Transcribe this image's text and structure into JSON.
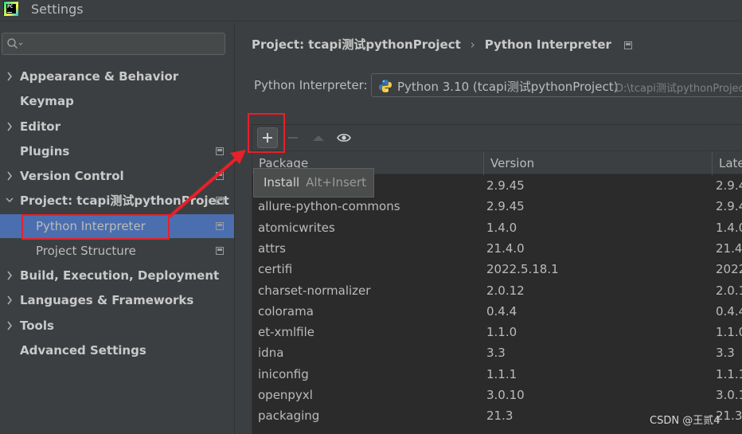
{
  "window": {
    "title": "Settings"
  },
  "sidebar": {
    "search_placeholder": "",
    "items": [
      {
        "label": "Appearance & Behavior",
        "expandable": true,
        "expanded": false
      },
      {
        "label": "Keymap",
        "expandable": false
      },
      {
        "label": "Editor",
        "expandable": true,
        "expanded": false
      },
      {
        "label": "Plugins",
        "expandable": false
      },
      {
        "label": "Version Control",
        "expandable": true,
        "expanded": false
      },
      {
        "label": "Project: tcapi测试pythonProject",
        "expandable": true,
        "expanded": true
      },
      {
        "label": "Python Interpreter",
        "selected": true
      },
      {
        "label": "Project Structure"
      },
      {
        "label": "Build, Execution, Deployment",
        "expandable": true,
        "expanded": false
      },
      {
        "label": "Languages & Frameworks",
        "expandable": true,
        "expanded": false
      },
      {
        "label": "Tools",
        "expandable": true,
        "expanded": false
      },
      {
        "label": "Advanced Settings",
        "expandable": false
      }
    ]
  },
  "breadcrumb": {
    "project": "Project: tcapi测试pythonProject",
    "separator": "›",
    "page": "Python Interpreter"
  },
  "interpreter": {
    "label": "Python Interpreter:",
    "name": "Python 3.10 (tcapi测试pythonProject)",
    "path": "D:\\tcapi测试pythonProject"
  },
  "toolbar": {
    "add_icon": "plus-icon",
    "remove_icon": "minus-icon",
    "upgrade_icon": "triangle-up-icon",
    "show_early_icon": "eye-icon"
  },
  "tooltip": {
    "label": "Install",
    "shortcut": "Alt+Insert"
  },
  "table": {
    "columns": [
      "Package",
      "Version",
      "Late"
    ],
    "rows": [
      [
        "",
        "2.9.45",
        "2.9.4"
      ],
      [
        "allure-python-commons",
        "2.9.45",
        "2.9.4"
      ],
      [
        "atomicwrites",
        "1.4.0",
        "1.4.0"
      ],
      [
        "attrs",
        "21.4.0",
        "21.4."
      ],
      [
        "certifi",
        "2022.5.18.1",
        "2022"
      ],
      [
        "charset-normalizer",
        "2.0.12",
        "2.0.1"
      ],
      [
        "colorama",
        "0.4.4",
        "0.4.4"
      ],
      [
        "et-xmlfile",
        "1.1.0",
        "1.1.0"
      ],
      [
        "idna",
        "3.3",
        "3.3"
      ],
      [
        "iniconfig",
        "1.1.1",
        "1.1.1"
      ],
      [
        "openpyxl",
        "3.0.10",
        "3.0.1"
      ],
      [
        "packaging",
        "21.3",
        "21.3"
      ]
    ]
  },
  "watermark": "CSDN @王贰4",
  "colors": {
    "selection": "#4b6eaf",
    "annotation": "#e8202a",
    "background": "#3c3f41",
    "table_bg": "#2b2b2b"
  }
}
